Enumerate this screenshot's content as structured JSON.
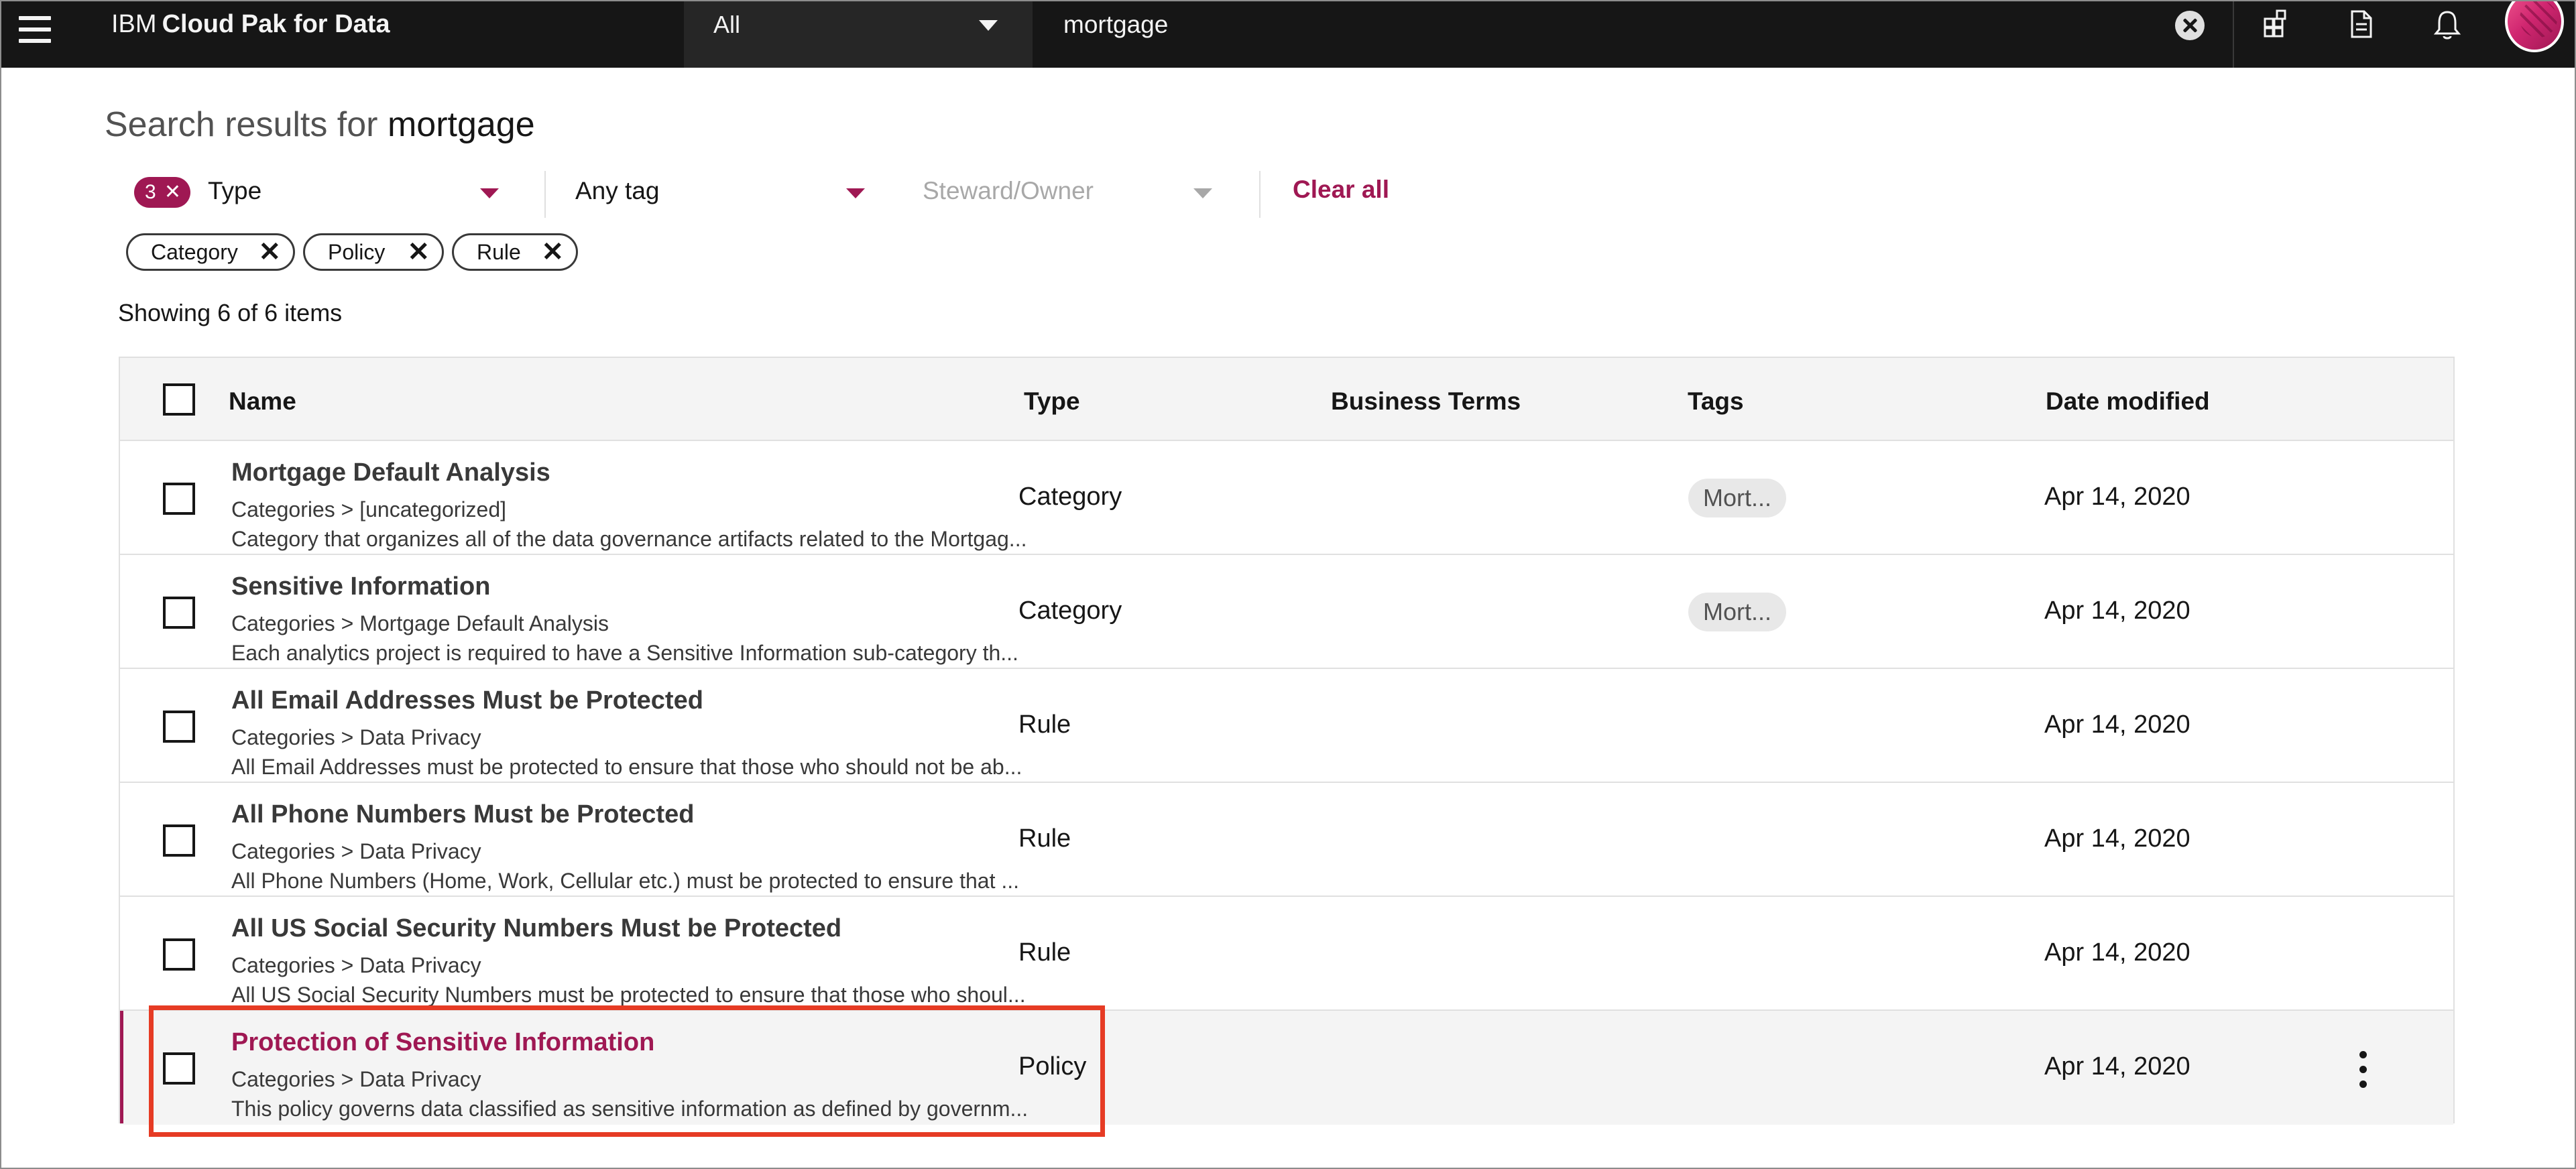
{
  "header": {
    "brand_prefix": "IBM",
    "brand_product": "Cloud Pak for Data",
    "scope": "All",
    "search_value": "mortgage",
    "icons": [
      "menu-icon",
      "caret-down-icon",
      "clear-search-icon",
      "catalog-icon",
      "document-icon",
      "notification-icon",
      "avatar"
    ]
  },
  "page": {
    "title_prefix": "Search results for",
    "title_query": "mortgage",
    "showing": "Showing 6 of 6 items"
  },
  "filters": {
    "type_count": "3",
    "type_label": "Type",
    "tag_label": "Any tag",
    "steward_label": "Steward/Owner",
    "clear_all": "Clear all",
    "chips": [
      "Category",
      "Policy",
      "Rule"
    ]
  },
  "table": {
    "columns": [
      "Name",
      "Type",
      "Business Terms",
      "Tags",
      "Date modified"
    ],
    "rows": [
      {
        "name": "Mortgage Default Analysis",
        "path": "Categories > [uncategorized]",
        "desc": "Category that organizes all of the data governance artifacts related to the Mortgag...",
        "type": "Category",
        "tag": "Mort...",
        "date": "Apr 14, 2020"
      },
      {
        "name": "Sensitive Information",
        "path": "Categories > Mortgage Default Analysis",
        "desc": "Each analytics project is required to have a Sensitive Information sub-category th...",
        "type": "Category",
        "tag": "Mort...",
        "date": "Apr 14, 2020"
      },
      {
        "name": "All Email Addresses Must be Protected",
        "path": "Categories > Data Privacy",
        "desc": "All Email Addresses must be protected to ensure that those who should not be ab...",
        "type": "Rule",
        "tag": "",
        "date": "Apr 14, 2020"
      },
      {
        "name": "All Phone Numbers Must be Protected",
        "path": "Categories > Data Privacy",
        "desc": "All Phone Numbers (Home, Work, Cellular etc.) must be protected to ensure that ...",
        "type": "Rule",
        "tag": "",
        "date": "Apr 14, 2020"
      },
      {
        "name": "All US Social Security Numbers Must be Protected",
        "path": "Categories > Data Privacy",
        "desc": "All US Social Security Numbers must be protected to ensure that those who shoul...",
        "type": "Rule",
        "tag": "",
        "date": "Apr 14, 2020"
      },
      {
        "name": "Protection of Sensitive Information",
        "path": "Categories > Data Privacy",
        "desc": "This policy governs data classified as sensitive information as defined by governm...",
        "type": "Policy",
        "tag": "",
        "date": "Apr 14, 2020"
      }
    ]
  },
  "colors": {
    "accent": "#9f1853",
    "header_bg": "#161616",
    "highlight": "#e63b24"
  }
}
